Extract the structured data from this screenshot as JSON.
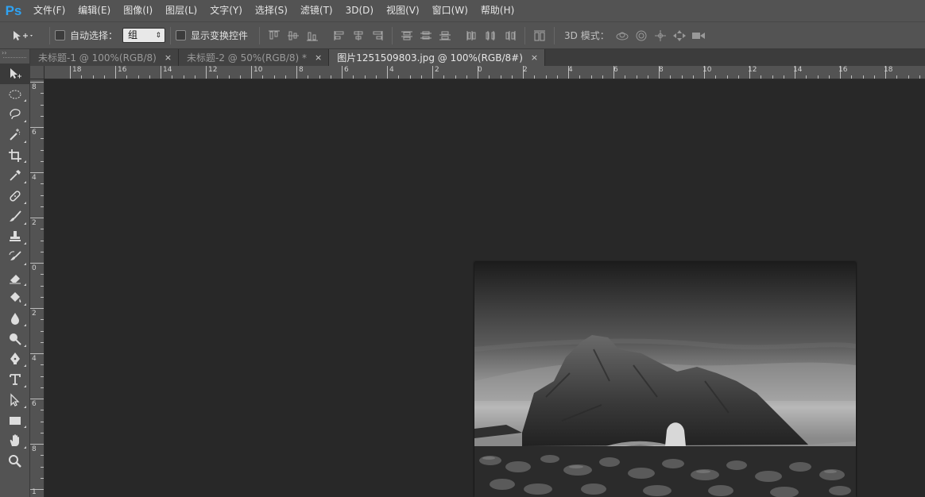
{
  "app": {
    "logo": "Ps"
  },
  "menu": [
    "文件(F)",
    "编辑(E)",
    "图像(I)",
    "图层(L)",
    "文字(Y)",
    "选择(S)",
    "滤镜(T)",
    "3D(D)",
    "视图(V)",
    "窗口(W)",
    "帮助(H)"
  ],
  "options": {
    "auto_select_label": "自动选择：",
    "auto_select_value": "组",
    "show_transform_label": "显示变换控件",
    "threed_mode_label": "3D 模式："
  },
  "tabs": [
    {
      "label": "未标题-1 @ 100%(RGB/8)",
      "close": "×",
      "active": false
    },
    {
      "label": "未标题-2 @ 50%(RGB/8) *",
      "close": "×",
      "active": false
    },
    {
      "label": "图片1251509803.jpg @ 100%(RGB/8#)",
      "close": "×",
      "active": true
    }
  ],
  "ruler_h": [
    "18",
    "16",
    "14",
    "12",
    "10",
    "8",
    "6",
    "4",
    "2",
    "0",
    "2",
    "4",
    "6",
    "8",
    "10",
    "12",
    "14",
    "16",
    "18"
  ],
  "ruler_v": [
    "8",
    "6",
    "4",
    "2",
    "0",
    "2",
    "4",
    "6",
    "8",
    "1"
  ],
  "tools": [
    {
      "icon": "move-tool-icon"
    },
    {
      "icon": "elliptical-marquee-icon"
    },
    {
      "icon": "lasso-icon"
    },
    {
      "icon": "magic-wand-icon"
    },
    {
      "icon": "crop-icon"
    },
    {
      "icon": "eyedropper-icon"
    },
    {
      "icon": "healing-brush-icon"
    },
    {
      "icon": "brush-icon"
    },
    {
      "icon": "clone-stamp-icon"
    },
    {
      "icon": "history-brush-icon"
    },
    {
      "icon": "eraser-icon"
    },
    {
      "icon": "paint-bucket-icon"
    },
    {
      "icon": "blur-icon"
    },
    {
      "icon": "dodge-icon"
    },
    {
      "icon": "pen-icon"
    },
    {
      "icon": "type-icon"
    },
    {
      "icon": "path-selection-icon"
    },
    {
      "icon": "rectangle-icon"
    },
    {
      "icon": "hand-icon"
    },
    {
      "icon": "zoom-icon"
    }
  ],
  "colors": {
    "menubar": "#535353",
    "canvas": "#282828",
    "logo": "#2fa3f3"
  }
}
